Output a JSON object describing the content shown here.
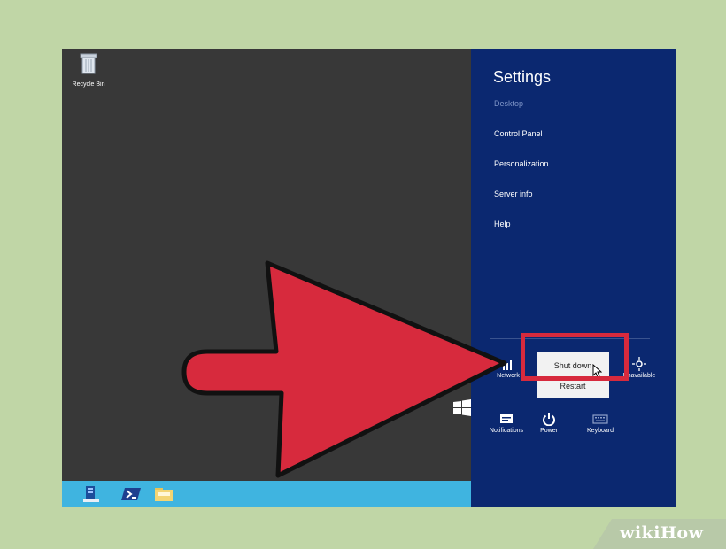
{
  "desktop": {
    "recycle_bin_label": "Recycle Bin",
    "taskbar_icons": [
      "server-manager-icon",
      "powershell-icon",
      "file-explorer-icon"
    ]
  },
  "settings_panel": {
    "title": "Settings",
    "items": [
      "Desktop",
      "Control Panel",
      "Personalization",
      "Server info",
      "Help"
    ],
    "network_label": "Network",
    "unavailable_label": "Unavailable",
    "bottom_row": [
      "Notifications",
      "Power",
      "Keyboard"
    ]
  },
  "power_menu": {
    "shut_down": "Shut down",
    "restart": "Restart"
  },
  "watermark": {
    "brand": "wikiHow"
  },
  "colors": {
    "settings_bg": "#0b2870",
    "desktop_bg": "#383838",
    "taskbar": "#3fb4e0",
    "arrow": "#d72a3d",
    "page_bg": "#c0d6a6"
  }
}
